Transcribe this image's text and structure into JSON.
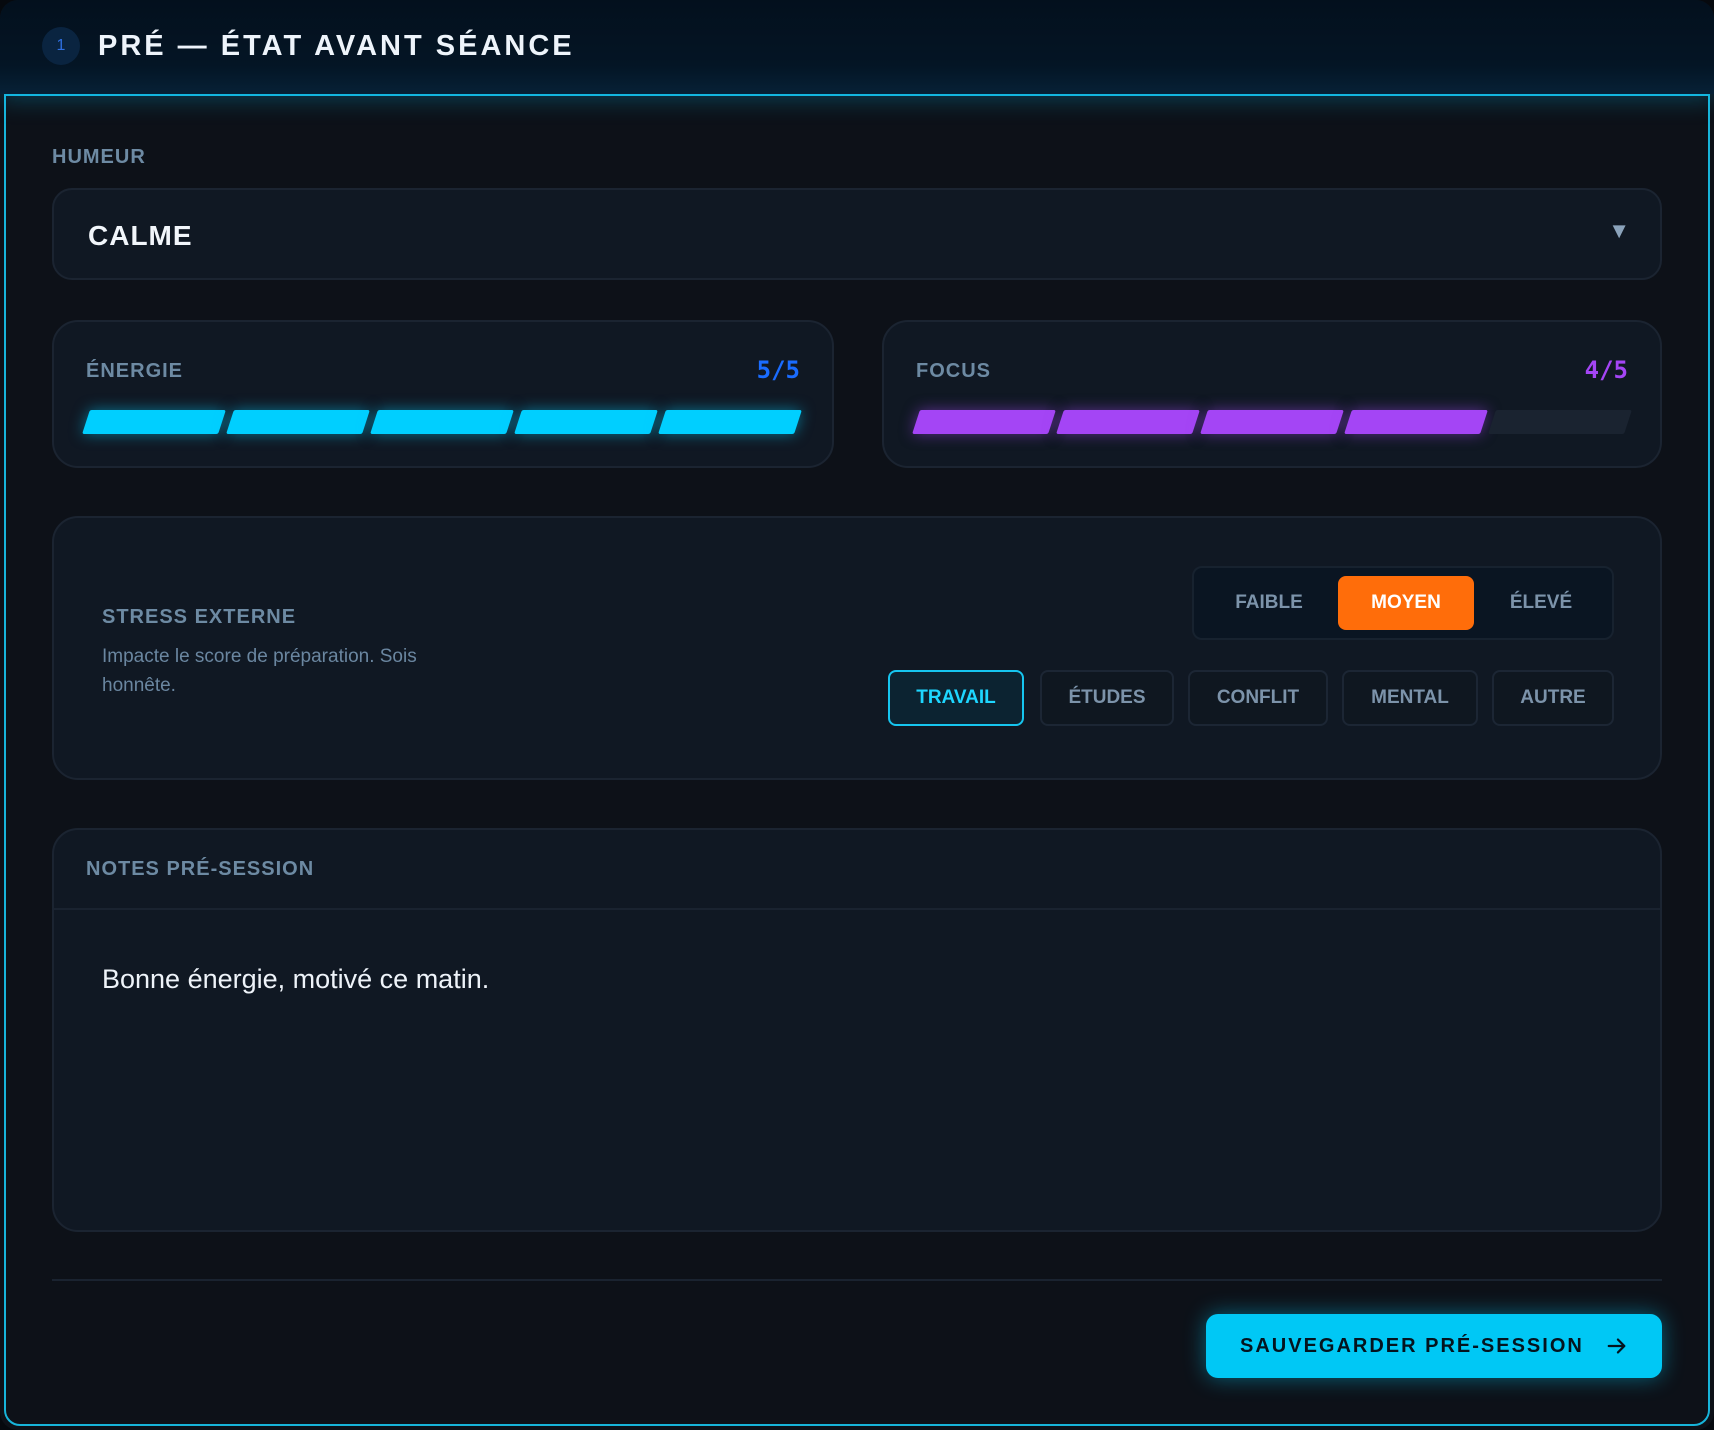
{
  "header": {
    "step_number": "1",
    "title": "PRÉ — ÉTAT AVANT SÉANCE"
  },
  "mood": {
    "label": "HUMEUR",
    "selected": "CALME"
  },
  "energy": {
    "label": "ÉNERGIE",
    "value_text": "5/5",
    "level": 5,
    "max": 5,
    "color": "#00cfff",
    "value_color": "#1a6cff"
  },
  "focus": {
    "label": "FOCUS",
    "value_text": "4/5",
    "level": 4,
    "max": 5,
    "color": "#a445f5",
    "value_color": "#a445f5"
  },
  "stress": {
    "title": "STRESS EXTERNE",
    "description": "Impacte le score de préparation. Sois honnête.",
    "levels": [
      "FAIBLE",
      "MOYEN",
      "ÉLEVÉ"
    ],
    "selected_level": "MOYEN",
    "level_color": "#ff6d0a",
    "sources": [
      "TRAVAIL",
      "ÉTUDES",
      "CONFLIT",
      "MENTAL",
      "AUTRE"
    ],
    "selected_source": "TRAVAIL"
  },
  "notes": {
    "title": "NOTES PRÉ-SESSION",
    "text": "Bonne énergie, motivé ce matin."
  },
  "actions": {
    "save_label": "SAUVEGARDER PRÉ-SESSION"
  }
}
